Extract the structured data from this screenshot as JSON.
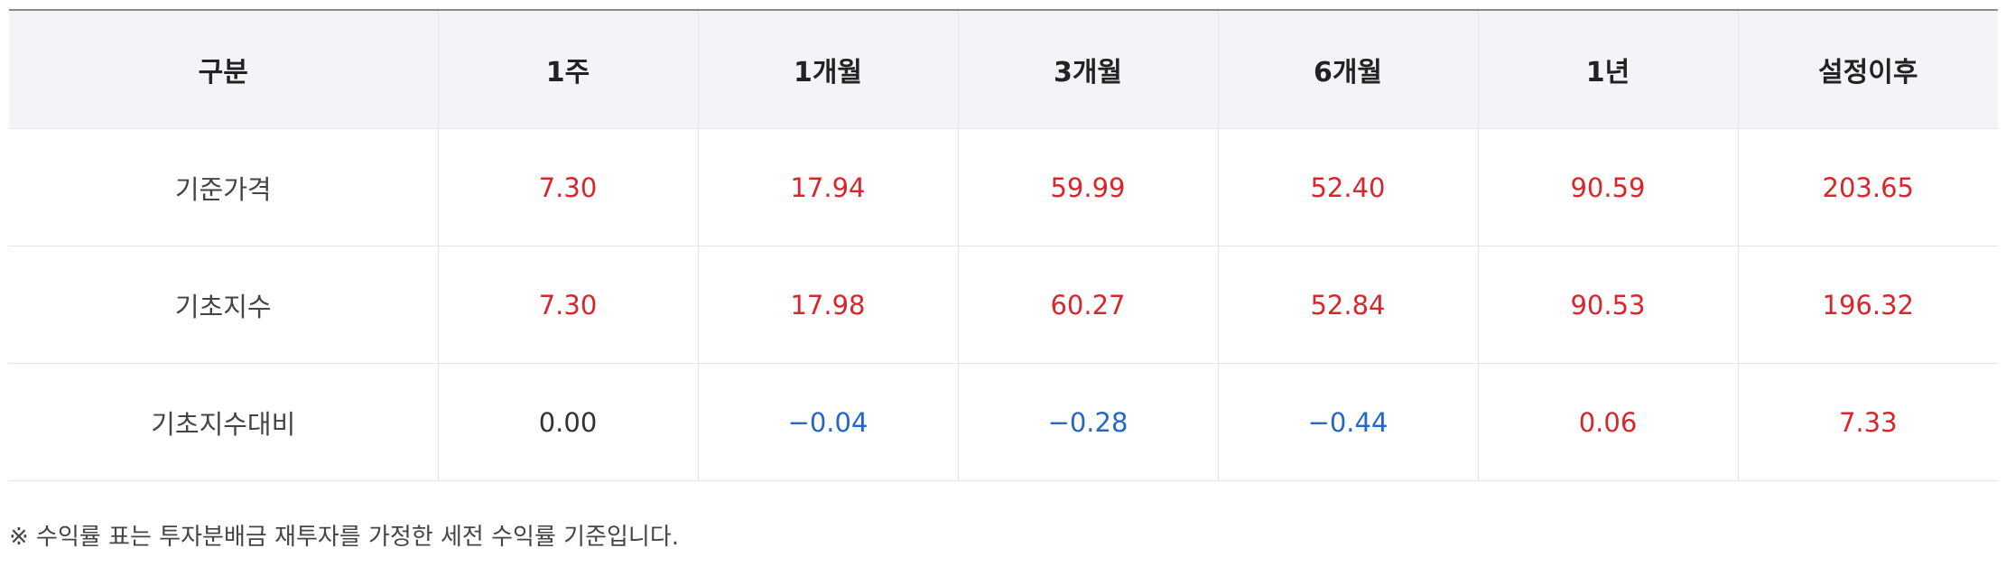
{
  "colors": {
    "positive": "#d7262c",
    "negative": "#2466c9",
    "neutral": "#333333"
  },
  "table": {
    "headers": [
      "구분",
      "1주",
      "1개월",
      "3개월",
      "6개월",
      "1년",
      "설정이후"
    ],
    "rows": [
      {
        "label": "기준가격",
        "values": [
          "7.30",
          "17.94",
          "59.99",
          "52.40",
          "90.59",
          "203.65"
        ],
        "tones": [
          "positive",
          "positive",
          "positive",
          "positive",
          "positive",
          "positive"
        ]
      },
      {
        "label": "기초지수",
        "values": [
          "7.30",
          "17.98",
          "60.27",
          "52.84",
          "90.53",
          "196.32"
        ],
        "tones": [
          "positive",
          "positive",
          "positive",
          "positive",
          "positive",
          "positive"
        ]
      },
      {
        "label": "기초지수대비",
        "values": [
          "0.00",
          "−0.04",
          "−0.28",
          "−0.44",
          "0.06",
          "7.33"
        ],
        "tones": [
          "neutral",
          "negative",
          "negative",
          "negative",
          "positive",
          "positive"
        ]
      }
    ]
  },
  "note": "※ 수익률 표는 투자분배금 재투자를 가정한 세전 수익률 기준입니다."
}
